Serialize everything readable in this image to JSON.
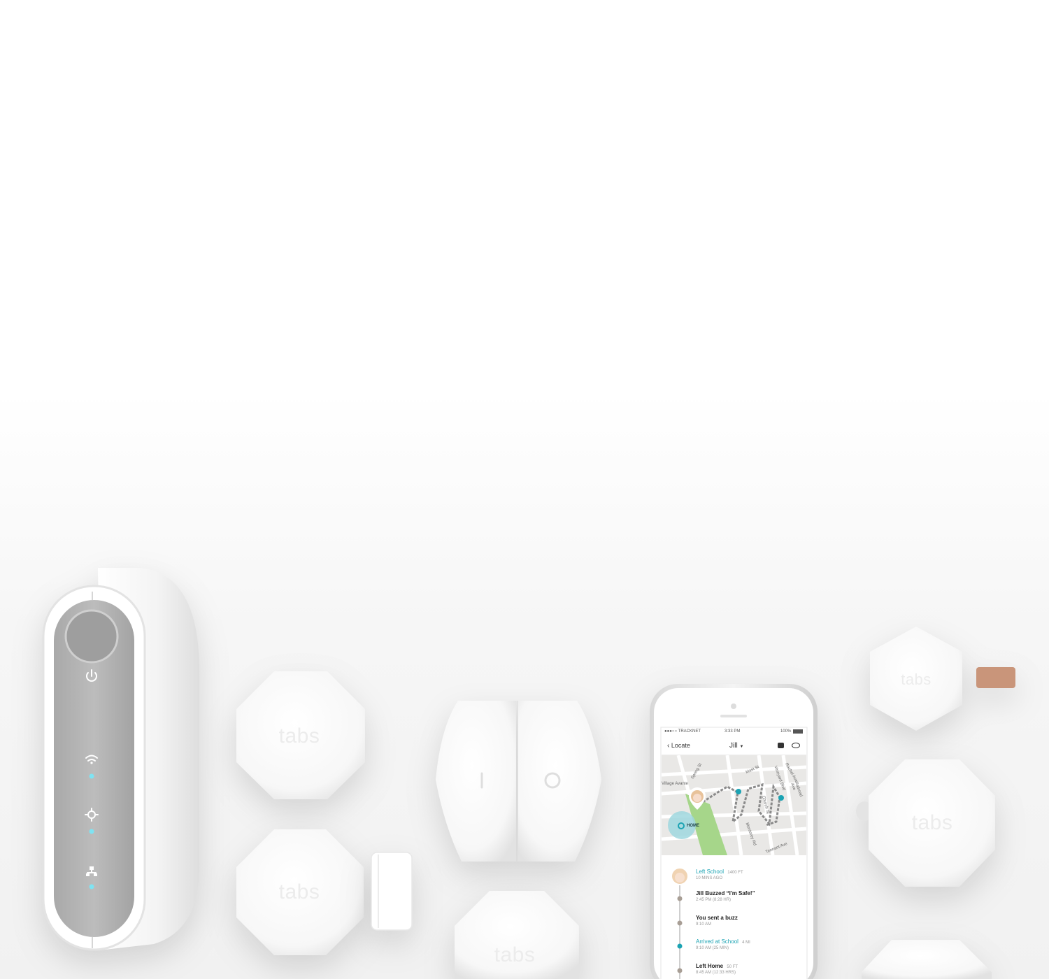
{
  "brand": {
    "logo_text": "tabs",
    "accent_color": "#1ba3b3",
    "strap_color": "#c9957a"
  },
  "hub": {
    "icons": [
      "power-icon",
      "wifi-icon",
      "gps-target-icon",
      "network-icon"
    ]
  },
  "phone": {
    "status_bar": {
      "carrier": "●●●○○ TRACKNET",
      "time": "3:33 PM",
      "battery": "100%"
    },
    "nav": {
      "back_label": "Locate",
      "title": "Jill",
      "icons": [
        "chat-bubble-icon",
        "eye-icon"
      ]
    },
    "map": {
      "labels": [
        "Village Avante",
        "Spring St",
        "Mast St",
        "Rachel Ave",
        "Monterey Rd",
        "Tennant Ave",
        "Vineyard Blvd",
        "Railroad Ave",
        "Church St"
      ],
      "home_label": "HOME"
    },
    "timeline": [
      {
        "title": "Left School",
        "meta": "1400 FT",
        "sub": "10 MINS AGO",
        "highlight": true
      },
      {
        "title": "Jill Buzzed “I'm Safe!”",
        "meta": "",
        "sub": "2:45 PM (8:28 HR)",
        "highlight": false
      },
      {
        "title": "You sent a buzz",
        "meta": "",
        "sub": "9:10 AM",
        "highlight": false
      },
      {
        "title": "Arrived at School",
        "meta": "4 MI",
        "sub": "9:10 AM (25 MIN)",
        "highlight": true
      },
      {
        "title": "Left Home",
        "meta": "50 FT",
        "sub": "8:45 AM (12:33 HRS)",
        "highlight": false
      }
    ]
  }
}
